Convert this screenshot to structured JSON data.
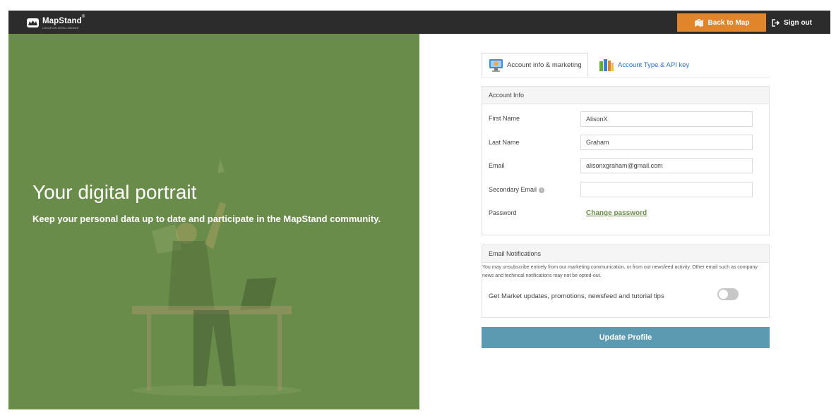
{
  "brand": {
    "name": "MapStand",
    "trademark": "®",
    "tagline": "LOCATION INTELLIGENCE"
  },
  "nav": {
    "back_label": "Back to Map",
    "signout_label": "Sign out"
  },
  "hero": {
    "title": "Your digital portrait",
    "subtitle": "Keep your personal data up to date and participate in the MapStand community."
  },
  "tabs": [
    {
      "label": "Account info & marketing",
      "active": true
    },
    {
      "label": "Account Type & API key",
      "active": false
    }
  ],
  "account_info": {
    "heading": "Account Info",
    "first_name": {
      "label": "First Name",
      "value": "AlisonX"
    },
    "last_name": {
      "label": "Last Name",
      "value": "Graham"
    },
    "email": {
      "label": "Email",
      "value": "alisonxgraham@gmail.com"
    },
    "secondary_email": {
      "label": "Secondary Email",
      "value": ""
    },
    "password": {
      "label": "Password",
      "link": "Change password"
    }
  },
  "notifications": {
    "heading": "Email Notifications",
    "description": "You may unsubscribe entirely from our marketing communication, or from out newsfeed activity. Other email such as company news and techincal notifications may not be opted-out.",
    "option_label": "Get Market updates, promotions, newsfeed and tutorial tips",
    "option_enabled": false
  },
  "update_label": "Update Profile",
  "colors": {
    "navbar": "#2c2c2c",
    "accent_orange": "#e0852c",
    "hero_green": "#6a8c4a",
    "link_green": "#6a8c4a",
    "tab_link_blue": "#2f6fc4",
    "update_button": "#5b9ab1"
  }
}
